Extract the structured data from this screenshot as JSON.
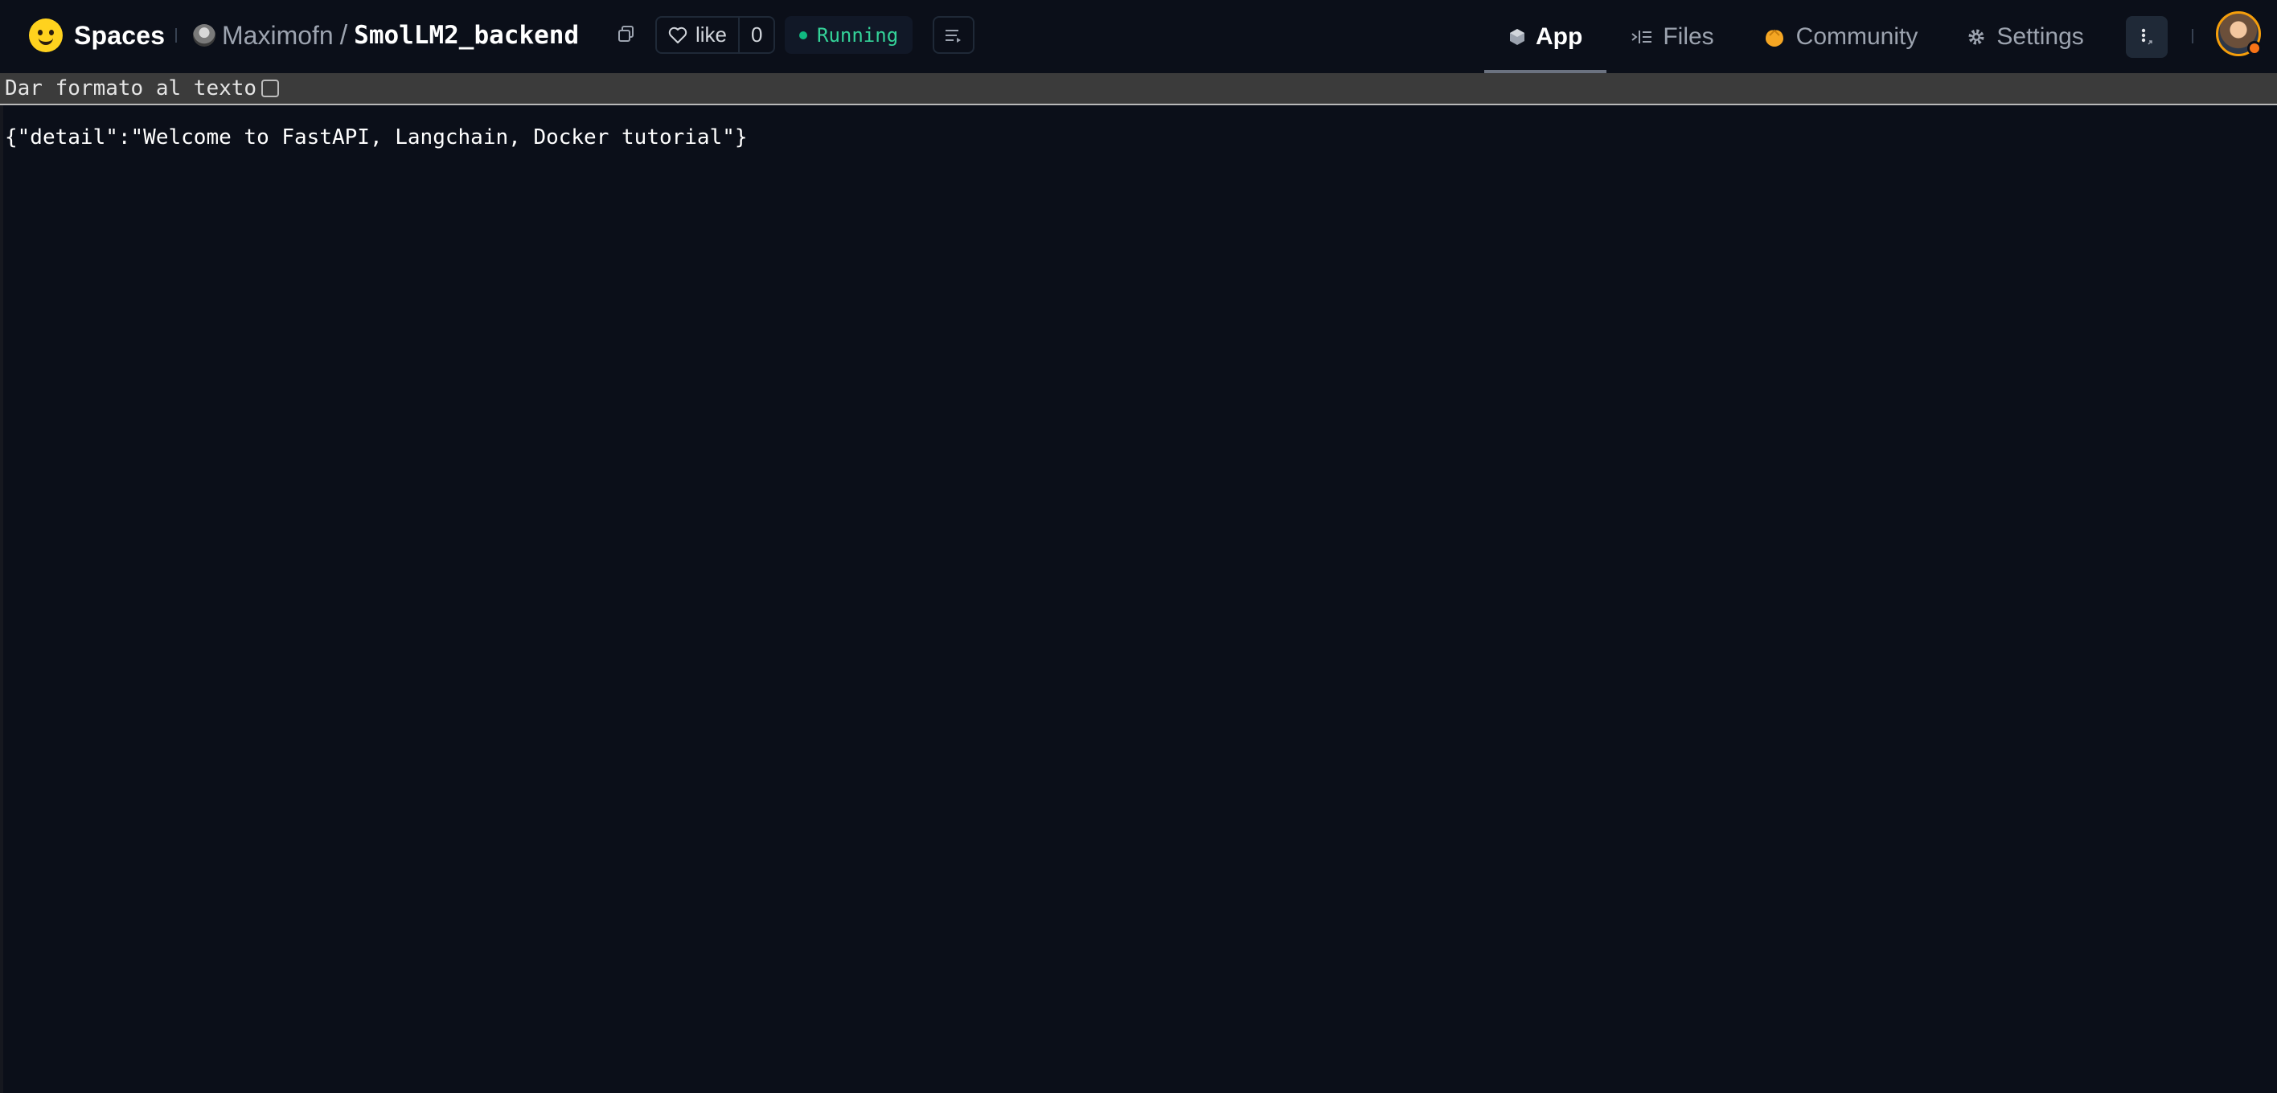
{
  "header": {
    "brand_label": "Spaces",
    "owner": "Maximofn",
    "separator": "/",
    "repo_name": "SmolLM2_backend",
    "like_label": "like",
    "like_count": "0",
    "status_label": "Running",
    "status_color": "#10b981"
  },
  "nav": {
    "tabs": [
      {
        "label": "App",
        "icon": "cube-icon",
        "active": true
      },
      {
        "label": "Files",
        "icon": "files-icon",
        "active": false
      },
      {
        "label": "Community",
        "icon": "community-icon",
        "active": false
      },
      {
        "label": "Settings",
        "icon": "gear-icon",
        "active": false
      }
    ]
  },
  "toolbar": {
    "pretty_print_label": "Dar formato al texto",
    "pretty_print_checked": false
  },
  "response": {
    "body": "{\"detail\":\"Welcome to FastAPI, Langchain, Docker tutorial\"}"
  }
}
